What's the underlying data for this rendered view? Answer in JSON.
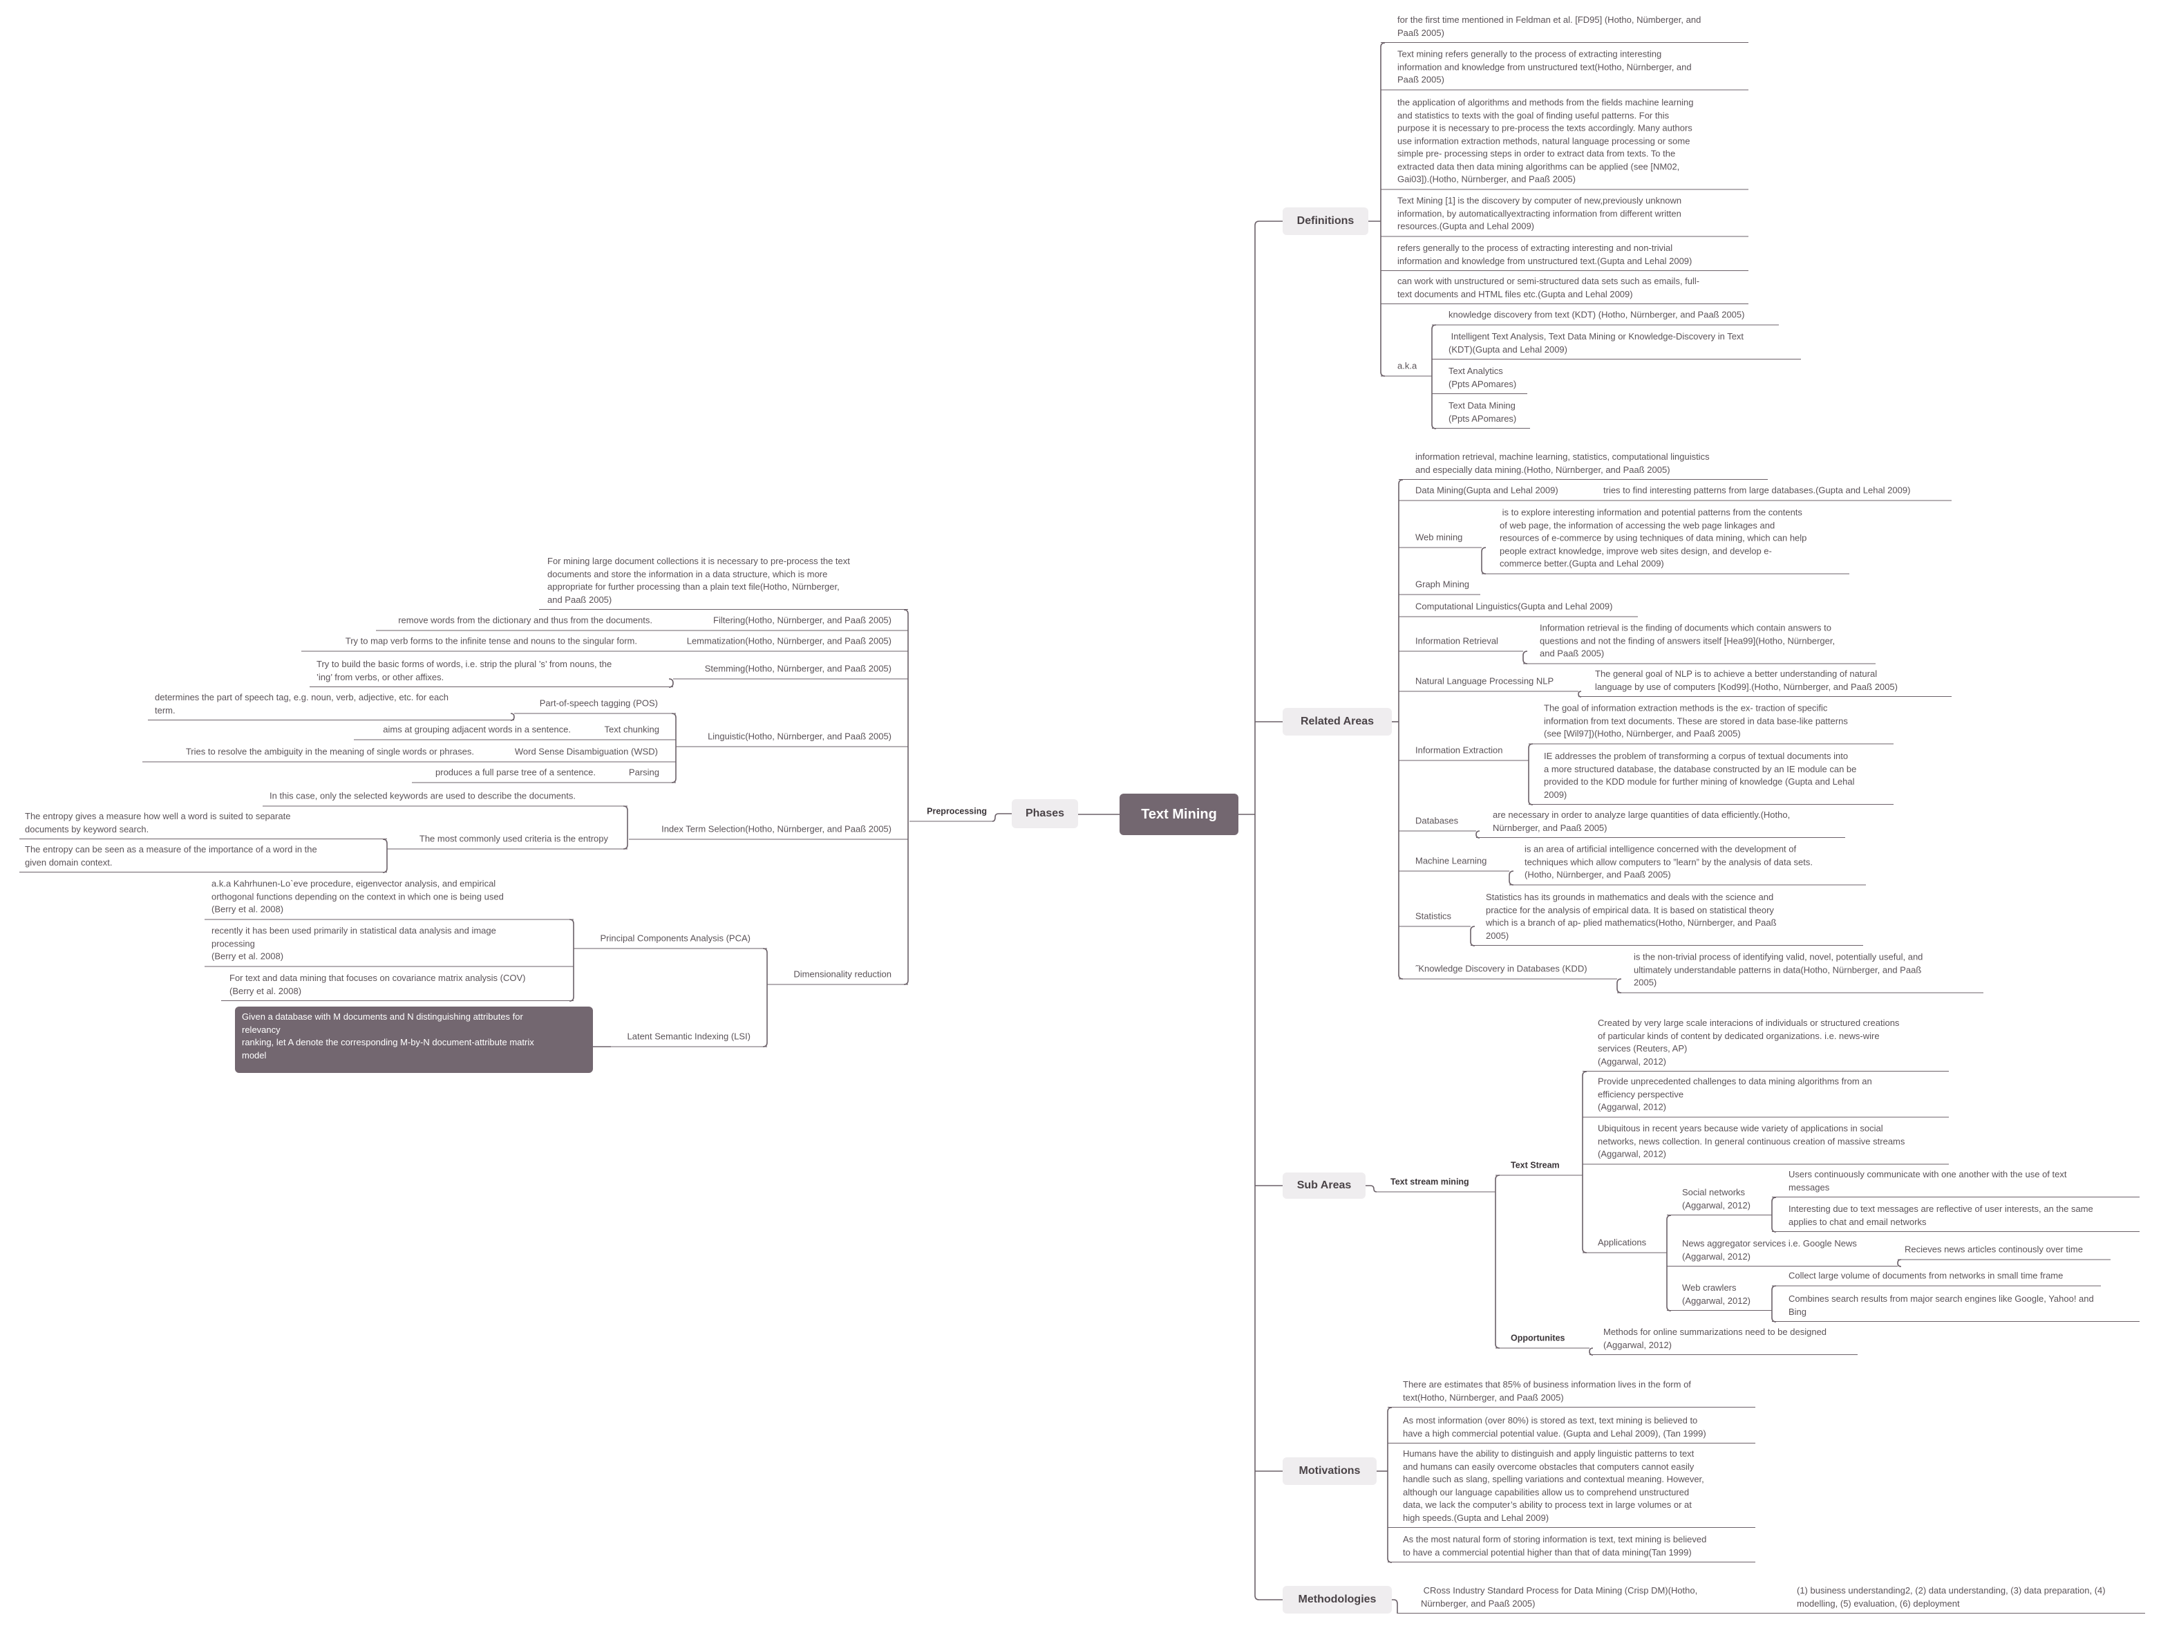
{
  "map": {
    "central_topic": "Text Mining",
    "phases": {
      "label": "Phases",
      "preprocessing": {
        "label": "Preprocessing",
        "intro": "For mining large document collections it is necessary to pre-process the text\ndocuments and store the information in a data structure, which is more\nappropriate for further processing than a plain text file(Hotho, Nürnberger,\nand Paaß 2005)",
        "filtering": {
          "label": "Filtering(Hotho, Nürnberger, and Paaß 2005)",
          "detail": "remove words from the dictionary and thus from the documents."
        },
        "lemmatization": {
          "label": "Lemmatization(Hotho, Nürnberger, and Paaß 2005)",
          "detail": "Try to map verb forms to the infinite tense and nouns to the singular form."
        },
        "stemming": {
          "label": "Stemming(Hotho, Nürnberger, and Paaß 2005)",
          "detail": "Try to build the basic forms of words, i.e. strip the plural ’s’ from nouns, the\n’ing’ from verbs, or other affixes."
        },
        "linguistic": {
          "label": "Linguistic(Hotho, Nürnberger, and Paaß 2005)",
          "items": [
            {
              "label": "Part-of-speech tagging (POS)",
              "detail": "determines the part of speech tag, e.g. noun, verb, adjective, etc. for each\nterm."
            },
            {
              "label": "Text chunking",
              "detail": "aims at grouping adjacent words in a sentence."
            },
            {
              "label": "Word Sense Disambiguation (WSD)",
              "detail": "Tries to resolve the ambiguity in the meaning of single words or phrases."
            },
            {
              "label": "Parsing",
              "detail": "produces a full parse tree of a sentence."
            }
          ]
        },
        "index_term_selection": {
          "label": "Index Term Selection(Hotho, Nürnberger, and Paaß 2005)",
          "keywords_note": "In this case, only the selected keywords are used to describe the documents.",
          "entropy": {
            "label": "The most commonly used criteria is the entropy",
            "items": [
              "The entropy gives a measure how well a word is suited to separate\ndocuments by keyword search.",
              "The entropy can be seen as a measure of the importance of a word in the\ngiven domain context."
            ]
          }
        },
        "dimensionality_reduction": {
          "label": "Dimensionality reduction",
          "pca": {
            "label": "Principal Components Analysis (PCA)",
            "items": [
              "a.k.a Kahrhunen-Lo`eve procedure, eigenvector analysis, and empirical\northogonal functions depending on the context in which one is being used\n(Berry et al. 2008)",
              "recently it has been used primarily in statistical data analysis and image\nprocessing\n(Berry et al. 2008)",
              "For text and data mining that focuses on covariance matrix analysis (COV)\n(Berry et al. 2008)"
            ]
          },
          "lsi": {
            "label": "Latent Semantic Indexing (LSI)",
            "detail": "Given a database with M documents and N distinguishing attributes for\nrelevancy\nranking, let A denote the corresponding M-by-N document-attribute matrix\nmodel"
          }
        }
      }
    },
    "definitions": {
      "label": "Definitions",
      "items": [
        "for the first time mentioned in Feldman et al. [FD95] (Hotho, Nümberger, and\nPaaß 2005)",
        "Text mining refers generally to the process of extracting interesting\ninformation and knowledge from unstructured text(Hotho, Nürnberger, and\nPaaß 2005)",
        "the application of algorithms and methods from the fields machine learning\nand statistics to texts with the goal of finding useful patterns. For this\npurpose it is necessary to pre-process the texts accordingly. Many authors\nuse information extraction methods, natural language processing or some\nsimple pre- processing steps in order to extract data from texts. To the\nextracted data then data mining algorithms can be applied (see [NM02,\nGai03]).(Hotho, Nürnberger, and Paaß 2005)",
        "Text Mining [1] is the discovery by computer of new,previously unknown\ninformation, by automaticallyextracting information from different written\nresources.(Gupta and Lehal 2009)",
        "refers generally to the process of extracting interesting and non-trivial\ninformation and knowledge from unstructured text.(Gupta and Lehal 2009)",
        "can work with unstructured or semi-structured data sets such as emails, full-\ntext documents and HTML files etc.(Gupta and Lehal 2009)"
      ],
      "aka": {
        "label": "a.k.a",
        "items": [
          "knowledge discovery from text (KDT) (Hotho, Nürnberger, and Paaß 2005)",
          " Intelligent Text Analysis, Text Data Mining or Knowledge-Discovery in Text\n(KDT)(Gupta and Lehal 2009)",
          "Text Analytics\n(Ppts APomares)",
          "Text Data Mining\n(Ppts APomares)"
        ]
      }
    },
    "related_areas": {
      "label": "Related Areas",
      "overview": "information retrieval, machine learning, statistics, computational linguistics\nand especially data mining.(Hotho, Nürnberger, and Paaß 2005)",
      "items": [
        {
          "label": "Data Mining(Gupta and Lehal 2009)",
          "details": [
            "tries to find interesting patterns from large databases.(Gupta and Lehal 2009)"
          ]
        },
        {
          "label": "Web mining",
          "details": [
            " is to explore interesting information and potential patterns from the contents\nof web page, the information of accessing the web page linkages and\nresources of e-commerce by using techniques of data mining, which can help\npeople extract knowledge, improve web sites design, and develop e-\ncommerce better.(Gupta and Lehal 2009)"
          ]
        },
        {
          "label": "Graph Mining",
          "details": []
        },
        {
          "label": "Computational Linguistics(Gupta and Lehal 2009)",
          "details": []
        },
        {
          "label": "Information Retrieval",
          "details": [
            "Information retrieval is the finding of documents which contain answers to\nquestions and not the finding of answers itself [Hea99](Hotho, Nürnberger,\nand Paaß 2005)"
          ]
        },
        {
          "label": "Natural Language Processing NLP",
          "details": [
            "The general goal of NLP is to achieve a better understanding of natural\nlanguage by use of computers [Kod99].(Hotho, Nürnberger, and Paaß 2005)"
          ]
        },
        {
          "label": "Information Extraction",
          "details": [
            "The goal of information extraction methods is the ex- traction of specific\ninformation from text documents. These are stored in data base-like patterns\n(see [Wil97])(Hotho, Nürnberger, and Paaß 2005)",
            "IE addresses the problem of transforming a corpus of textual documents into\na more structured database, the database constructed by an IE module can be\nprovided to the KDD module for further mining of knowledge (Gupta and Lehal\n2009)"
          ]
        },
        {
          "label": "Databases",
          "details": [
            "are necessary in order to analyze large quantities of data efficiently.(Hotho,\nNürnberger, and Paaß 2005)"
          ]
        },
        {
          "label": "Machine Learning",
          "details": [
            "is an area of artificial intelligence concerned with the development of\ntechniques which allow computers to ”learn” by the analysis of data sets.\n(Hotho, Nürnberger, and Paaß 2005)"
          ]
        },
        {
          "label": "Statistics",
          "details": [
            "Statistics has its grounds in mathematics and deals with the science and\npractice for the analysis of empirical data. It is based on statistical theory\nwhich is a branch of ap- plied mathematics(Hotho, Nürnberger, and Paaß\n2005)"
          ]
        },
        {
          "label": "˝Knowledge Discovery in Databases (KDD)",
          "details": [
            "is the non-trivial process of identifying valid, novel, potentially useful, and\nultimately understandable patterns in data(Hotho, Nürnberger, and Paaß\n2005)"
          ]
        }
      ]
    },
    "sub_areas": {
      "label": "Sub Areas",
      "text_stream_mining": {
        "label": "Text stream mining",
        "text_stream": {
          "label": "Text Stream",
          "notes": [
            "Created by very large scale interacions of individuals or structured creations\nof particular kinds of content by dedicated organizations. i.e. news-wire\nservices (Reuters, AP)\n(Aggarwal, 2012)",
            "Provide unprecedented challenges to data mining algorithms from an\nefficiency perspective\n(Aggarwal, 2012)",
            "Ubiquitous in recent years because wide variety of applications in social\nnetworks, news collection. In general continuous creation of massive streams\n(Aggarwal, 2012)"
          ],
          "applications": {
            "label": "Applications",
            "items": [
              {
                "label": "Social networks\n(Aggarwal, 2012)",
                "details": [
                  "Users continuously communicate with one another with the use of text\nmessages",
                  "Interesting due to text messages are reflective of user interests, an the same\napplies to chat and email networks"
                ]
              },
              {
                "label": "News aggregator services i.e. Google News\n(Aggarwal, 2012)",
                "details": [
                  "Recieves news articles continously over time"
                ]
              },
              {
                "label": "Web crawlers\n(Aggarwal, 2012)",
                "details": [
                  "Collect large volume of documents from networks in small time frame",
                  "Combines search results from major search engines like Google, Yahoo! and\nBing"
                ]
              }
            ]
          }
        },
        "opportunities": {
          "label": "Opportunites",
          "details": [
            "Methods for online summarizations need to be designed\n(Aggarwal, 2012)"
          ]
        }
      }
    },
    "motivations": {
      "label": "Motivations",
      "items": [
        "There are estimates that 85% of business information lives in the form of\ntext(Hotho, Nürnberger, and Paaß 2005)",
        "As most information (over 80%) is stored as text, text mining is believed to\nhave a high commercial potential value. (Gupta and Lehal 2009), (Tan 1999)",
        "Humans have the ability to distinguish and apply linguistic patterns to text\nand humans can easily overcome obstacles that computers cannot easily\nhandle such as slang, spelling variations and contextual meaning. However,\nalthough our language capabilities allow us to comprehend unstructured\ndata, we lack the computer’s ability to process text in large volumes or at\nhigh speeds.(Gupta and Lehal 2009)",
        "As the most natural form of storing information is text, text mining is believed\nto have a commercial potential higher than that of data mining(Tan 1999)"
      ]
    },
    "methodologies": {
      "label": "Methodologies",
      "items": [
        {
          "label": " CRoss Industry Standard Process for Data Mining (Crisp DM)(Hotho,\nNürnberger, and Paaß 2005)",
          "details": [
            "(1) business understanding2, (2) data understanding, (3) data preparation, (4)\nmodelling, (5) evaluation, (6) deployment"
          ]
        }
      ]
    },
    "colors": {
      "central_topic_bg": "#736770",
      "main_topic_bg": "#efedef",
      "connector": "#6b6068",
      "text": "#5b5358"
    }
  }
}
